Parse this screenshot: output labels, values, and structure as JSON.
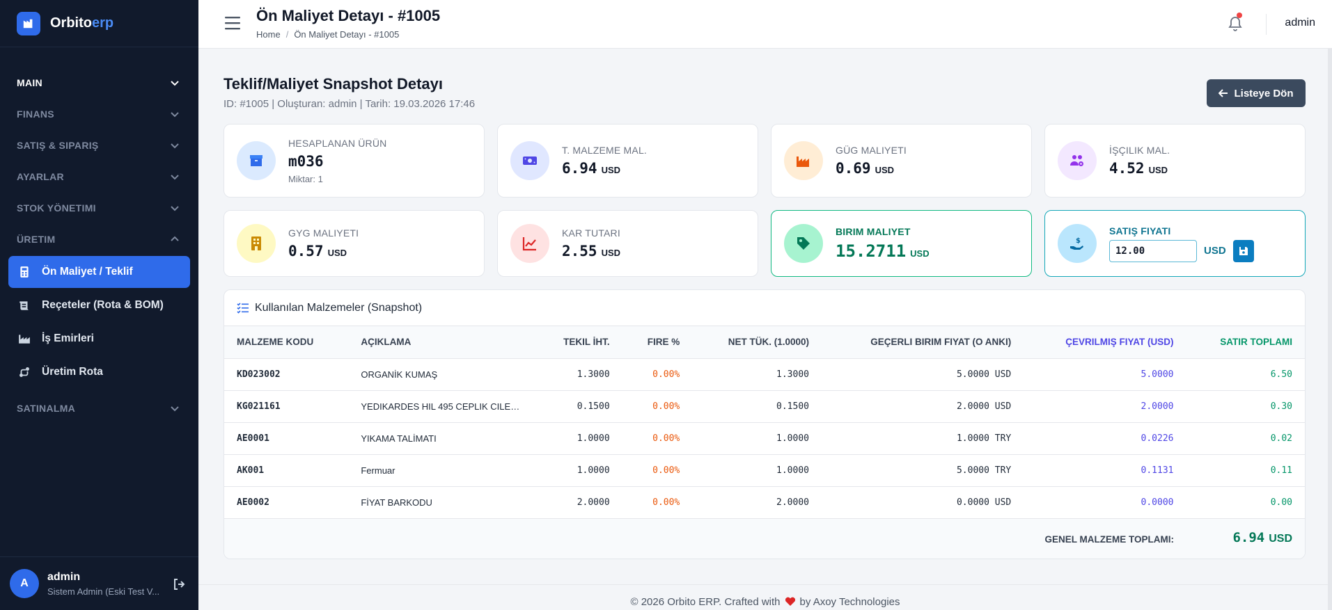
{
  "brand": {
    "name": "Orbito",
    "accent": "erp"
  },
  "sidebar": {
    "sections_top": [
      {
        "label": "MAIN",
        "active": true
      },
      {
        "label": "FINANS"
      },
      {
        "label": "SATIŞ & SIPARIŞ"
      },
      {
        "label": "AYARLAR"
      },
      {
        "label": "STOK YÖNETIMI"
      },
      {
        "label": "ÜRETIM"
      }
    ],
    "items": [
      {
        "label": "Ön Maliyet / Teklif",
        "icon": "calculator-icon"
      },
      {
        "label": "Reçeteler (Rota & BOM)",
        "icon": "scroll-icon"
      },
      {
        "label": "İş Emirleri",
        "icon": "factory-icon"
      },
      {
        "label": "Üretim Rota",
        "icon": "route-icon"
      }
    ],
    "section_bottom": {
      "label": "SATINALMA"
    },
    "user": {
      "initial": "A",
      "name": "admin",
      "role": "Sistem Admin (Eski Test V..."
    }
  },
  "topbar": {
    "title": "Ön Maliyet Detayı - #1005",
    "breadcrumb": [
      "Home",
      "Ön Maliyet Detayı - #1005"
    ],
    "user": "admin"
  },
  "header": {
    "title": "Teklif/Maliyet Snapshot Detayı",
    "subtitle": "ID: #1005 | Oluşturan: admin | Tarih: 19.03.2026 17:46",
    "back_label": "Listeye Dön"
  },
  "cards": {
    "product": {
      "label": "HESAPLANAN ÜRÜN",
      "value": "m036",
      "note": "Miktar: 1"
    },
    "material": {
      "label": "T. MALZEME MAL.",
      "value": "6.94",
      "unit": "USD"
    },
    "energy": {
      "label": "GÜG MALIYETI",
      "value": "0.69",
      "unit": "USD"
    },
    "labor": {
      "label": "İŞÇILIK MAL.",
      "value": "4.52",
      "unit": "USD"
    },
    "overhead": {
      "label": "GYG MALIYETI",
      "value": "0.57",
      "unit": "USD"
    },
    "profit": {
      "label": "KAR TUTARI",
      "value": "2.55",
      "unit": "USD"
    },
    "unit_cost": {
      "label": "BIRIM MALIYET",
      "value": "15.2711",
      "unit": "USD"
    },
    "sale_price": {
      "label": "SATIŞ FIYATI",
      "value": "12.00",
      "unit": "USD"
    }
  },
  "table": {
    "title": "Kullanılan Malzemeler (Snapshot)",
    "headers": [
      "MALZEME KODU",
      "AÇIKLAMA",
      "TEKIL İHT.",
      "FIRE %",
      "NET TÜK. (1.0000)",
      "GEÇERLI BIRIM FIYAT (O ANKI)",
      "ÇEVRILMIŞ FIYAT (USD)",
      "SATIR TOPLAMI"
    ],
    "rows": [
      [
        "KD023002",
        "ORGANİK KUMAŞ",
        "1.3000",
        "0.00%",
        "1.3000",
        "5.0000 USD",
        "5.0000",
        "6.50"
      ],
      [
        "KG021161",
        "YEDIKARDES HIL 495 CEPLIK CILEK ...",
        "0.1500",
        "0.00%",
        "0.1500",
        "2.0000 USD",
        "2.0000",
        "0.30"
      ],
      [
        "AE0001",
        "YIKAMA TALİMATI",
        "1.0000",
        "0.00%",
        "1.0000",
        "1.0000 TRY",
        "0.0226",
        "0.02"
      ],
      [
        "AK001",
        "Fermuar",
        "1.0000",
        "0.00%",
        "1.0000",
        "5.0000 TRY",
        "0.1131",
        "0.11"
      ],
      [
        "AE0002",
        "FİYAT BARKODU",
        "2.0000",
        "0.00%",
        "2.0000",
        "0.0000 USD",
        "0.0000",
        "0.00"
      ]
    ],
    "total_label": "GENEL MALZEME TOPLAMI:",
    "total_value": "6.94",
    "total_unit": "USD"
  },
  "footer": {
    "before": "© 2026 Orbito ERP. Crafted with",
    "after": "by Axoy Technologies"
  },
  "colors": {
    "sidebar": "#111a2c",
    "accent": "#2f6bea",
    "success": "#059669",
    "info": "#0e7490"
  }
}
